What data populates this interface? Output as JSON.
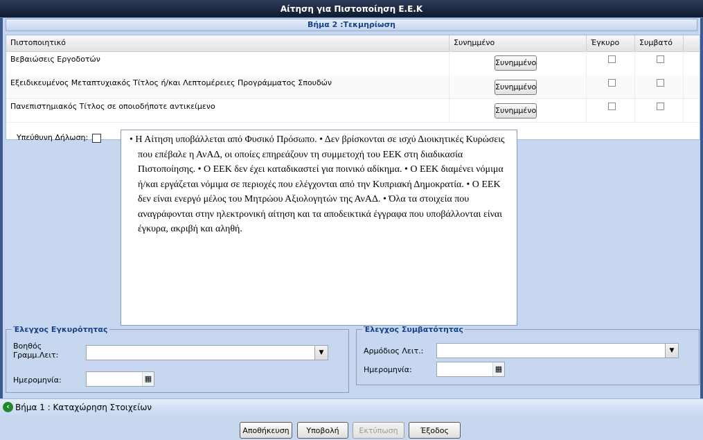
{
  "window": {
    "title": "Αίτηση για Πιστοποίηση Ε.Ε.Κ"
  },
  "step": {
    "title": "Βήμα 2 :Τεκμηρίωση"
  },
  "grid": {
    "headers": {
      "certificate": "Πιστοποιητικό",
      "attachment": "Συνημμένο",
      "valid": "Έγκυρο",
      "compatible": "Συμβατό"
    },
    "rows": [
      {
        "certificate": "Βεβαιώσεις Εργοδοτών",
        "button": "Συνημμένο"
      },
      {
        "certificate": "Εξειδικευμένος Μεταπτυχιακός Τίτλος ή/και Λεπτομέρειες Προγράμματος Σπουδών",
        "button": "Συνημμένο"
      },
      {
        "certificate": "Πανεπιστημιακός Τίτλος σε οποιοδήποτε αντικείμενο",
        "button": "Συνημμένο"
      }
    ]
  },
  "declaration": {
    "label": "Υπεύθυνη Δήλωση:",
    "text": "• Η Αίτηση υποβάλλεται από Φυσικό Πρόσωπο. • Δεν βρίσκονται σε ισχύ Διοικητικές Κυρώσεις που επέβαλε η ΑνΑΔ, οι οποίες επηρεάζουν τη συμμετοχή του ΕΕΚ στη διαδικασία Πιστοποίησης. • Ο ΕΕΚ δεν έχει καταδικαστεί για ποινικό αδίκημα. • Ο ΕΕΚ διαμένει νόμιμα ή/και εργάζεται νόμιμα σε περιοχές που ελέγχονται από την Κυπριακή Δημοκρατία. • Ο ΕΕΚ δεν είναι ενεργό μέλος του Μητρώου Αξιολογητών της ΑνΑΔ. • Όλα τα στοιχεία που αναγράφονται στην ηλεκτρονική αίτηση και τα αποδεικτικά έγγραφα που υποβάλλονται είναι έγκυρα, ακριβή και αληθή."
  },
  "validity": {
    "legend": "Έλεγχος Εγκυρότητας",
    "officer_label_1": "Βοηθός",
    "officer_label_2": "Γραμμ.Λειτ:",
    "date_label": "Ημερομηνία:"
  },
  "compatibility": {
    "legend": "Έλεγχος Συμβατότητας",
    "officer_label": "Αρμόδιος Λειτ.:",
    "date_label": "Ημερομηνία:"
  },
  "nav": {
    "back_label": "Βήμα 1 : Καταχώρηση Στοιχείων"
  },
  "footer": {
    "save": "Αποθήκευση",
    "submit": "Υποβολή",
    "print": "Εκτύπωση",
    "exit": "Έξοδος"
  },
  "icons": {
    "dropdown": "chevron-down-icon",
    "calendar": "calendar-icon",
    "back": "arrow-left-icon"
  },
  "colors": {
    "title_bar": "#1b2740",
    "panel": "#c6d7ef",
    "accent_text": "#15428b",
    "back_arrow": "#1c8a2a"
  }
}
